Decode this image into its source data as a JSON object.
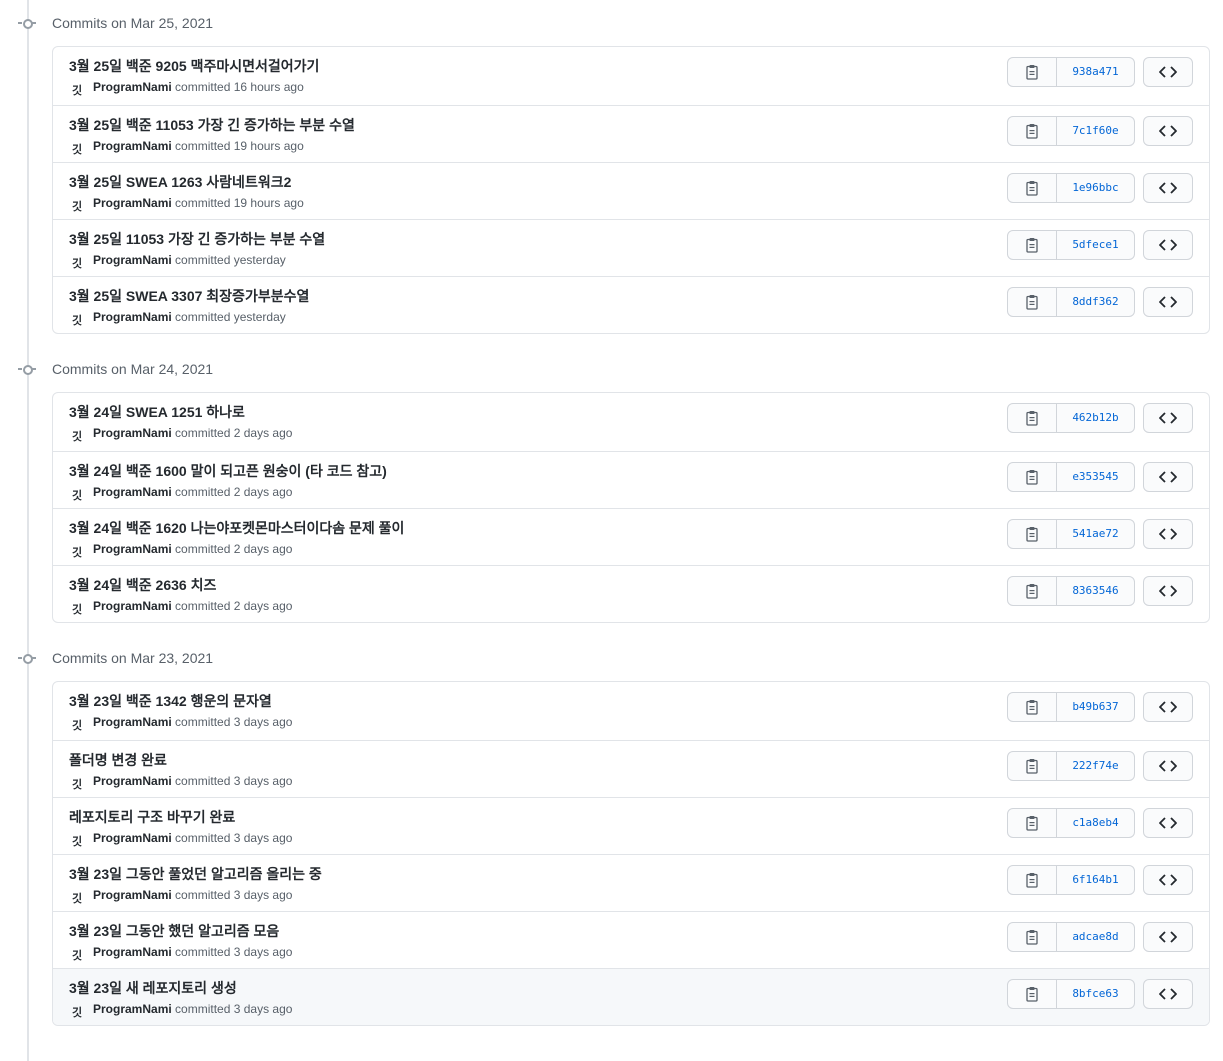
{
  "groups": [
    {
      "heading": "Commits on Mar 25, 2021",
      "commits": [
        {
          "title": "3월 25일 백준 9205 맥주마시면서걸어가기",
          "author": "ProgramNami",
          "time": "committed 16 hours ago",
          "sha": "938a471"
        },
        {
          "title": "3월 25일 백준 11053 가장 긴 증가하는 부분 수열",
          "author": "ProgramNami",
          "time": "committed 19 hours ago",
          "sha": "7c1f60e"
        },
        {
          "title": "3월 25일 SWEA 1263 사람네트워크2",
          "author": "ProgramNami",
          "time": "committed 19 hours ago",
          "sha": "1e96bbc"
        },
        {
          "title": "3월 25일 11053 가장 긴 증가하는 부분 수열",
          "author": "ProgramNami",
          "time": "committed yesterday",
          "sha": "5dfece1"
        },
        {
          "title": "3월 25일 SWEA 3307 최장증가부분수열",
          "author": "ProgramNami",
          "time": "committed yesterday",
          "sha": "8ddf362"
        }
      ]
    },
    {
      "heading": "Commits on Mar 24, 2021",
      "commits": [
        {
          "title": "3월 24일 SWEA 1251 하나로",
          "author": "ProgramNami",
          "time": "committed 2 days ago",
          "sha": "462b12b"
        },
        {
          "title": "3월 24일 백준 1600 말이 되고픈 원숭이 (타 코드 참고)",
          "author": "ProgramNami",
          "time": "committed 2 days ago",
          "sha": "e353545"
        },
        {
          "title": "3월 24일 백준 1620 나는야포켓몬마스터이다솜 문제 풀이",
          "author": "ProgramNami",
          "time": "committed 2 days ago",
          "sha": "541ae72"
        },
        {
          "title": "3월 24일 백준 2636 치즈",
          "author": "ProgramNami",
          "time": "committed 2 days ago",
          "sha": "8363546"
        }
      ]
    },
    {
      "heading": "Commits on Mar 23, 2021",
      "commits": [
        {
          "title": "3월 23일 백준 1342 행운의 문자열",
          "author": "ProgramNami",
          "time": "committed 3 days ago",
          "sha": "b49b637"
        },
        {
          "title": "폴더명 변경 완료",
          "author": "ProgramNami",
          "time": "committed 3 days ago",
          "sha": "222f74e"
        },
        {
          "title": "레포지토리 구조 바꾸기 완료",
          "author": "ProgramNami",
          "time": "committed 3 days ago",
          "sha": "c1a8eb4"
        },
        {
          "title": "3월 23일 그동안 풀었던 알고리즘 올리는 중",
          "author": "ProgramNami",
          "time": "committed 3 days ago",
          "sha": "6f164b1"
        },
        {
          "title": "3월 23일 그동안 했던 알고리즘 모음",
          "author": "ProgramNami",
          "time": "committed 3 days ago",
          "sha": "adcae8d"
        },
        {
          "title": "3월 23일 새 레포지토리 생성",
          "author": "ProgramNami",
          "time": "committed 3 days ago",
          "sha": "8bfce63",
          "highlight": true
        }
      ]
    }
  ],
  "icons": {
    "avatar": "깃",
    "copy": "clipboard-icon",
    "browse": "code-icon",
    "node": "git-commit-icon"
  },
  "colors": {
    "sha_link": "#0366d6",
    "muted": "#586069",
    "border": "#e1e4e8",
    "highlight_row": "#f6f8fa"
  }
}
